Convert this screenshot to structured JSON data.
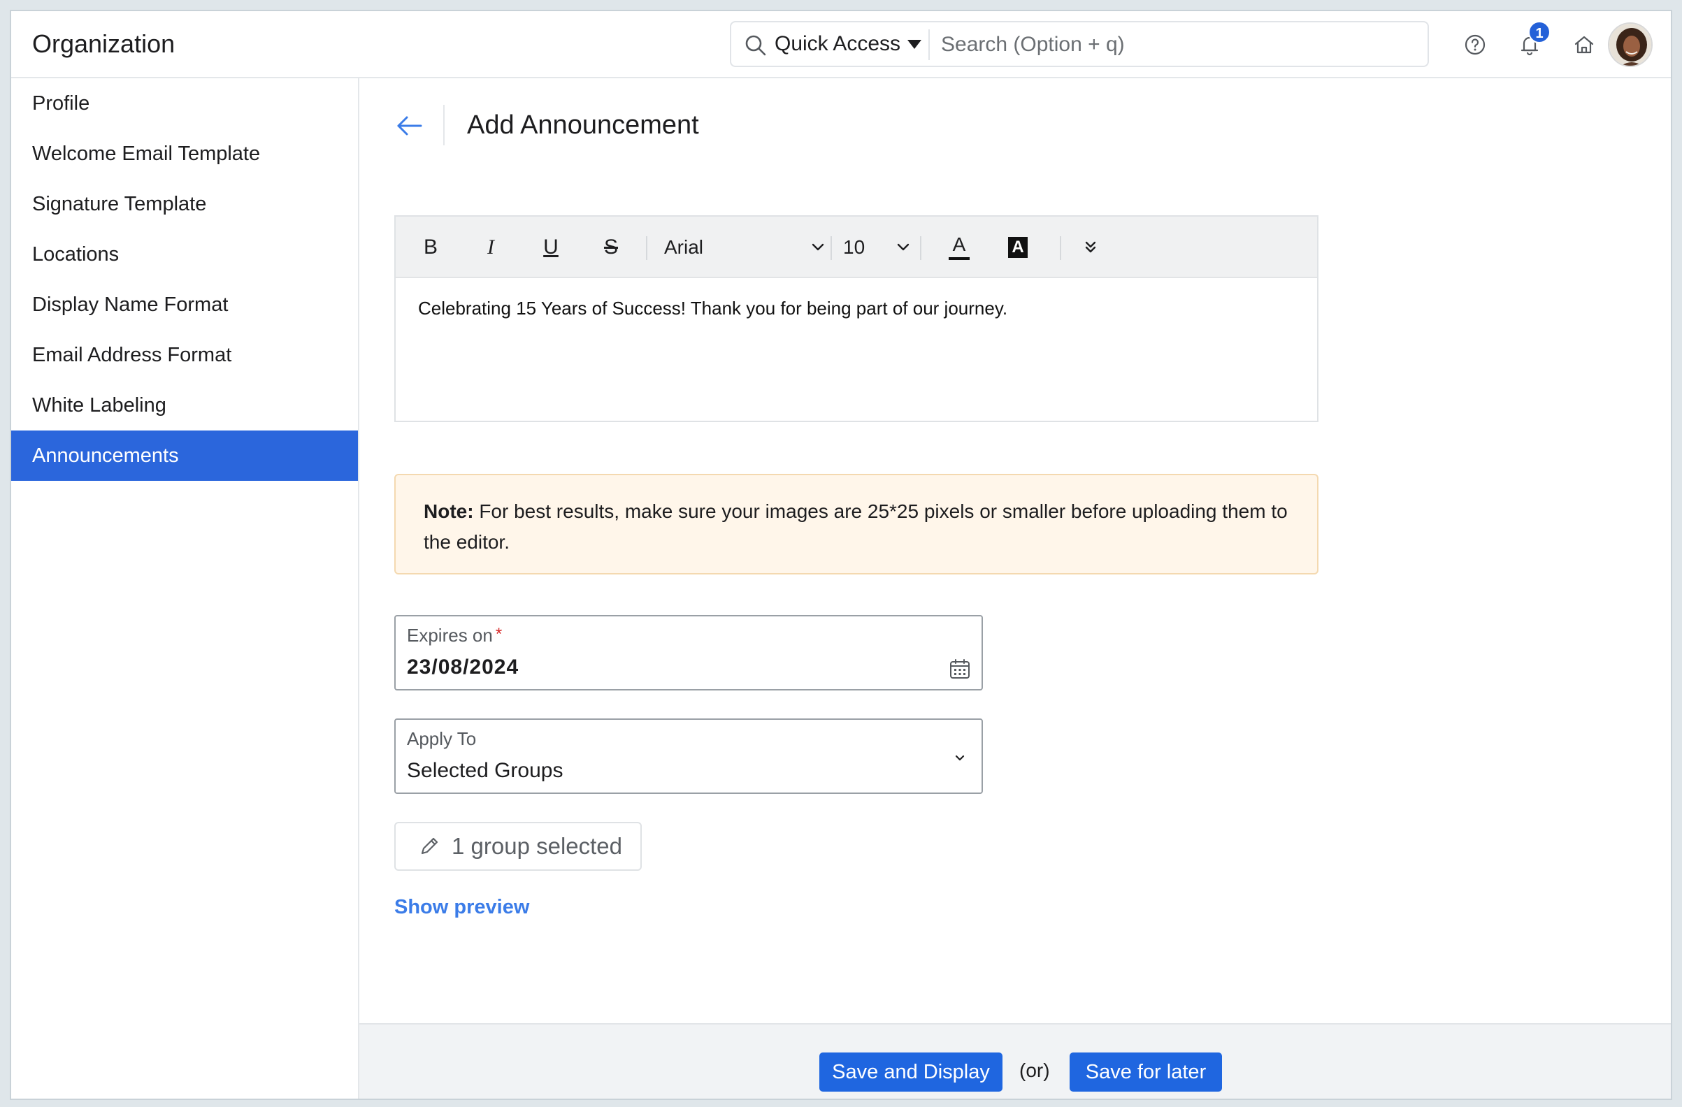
{
  "app": {
    "title": "Organization"
  },
  "header": {
    "quick_access_label": "Quick Access",
    "search_placeholder": "Search (Option + q)",
    "notification_count": "1"
  },
  "sidebar": {
    "items": [
      {
        "label": "Profile"
      },
      {
        "label": "Welcome Email Template"
      },
      {
        "label": "Signature Template"
      },
      {
        "label": "Locations"
      },
      {
        "label": "Display Name Format"
      },
      {
        "label": "Email Address Format"
      },
      {
        "label": "White Labeling"
      },
      {
        "label": "Announcements",
        "active": true
      }
    ]
  },
  "page": {
    "title": "Add Announcement"
  },
  "editor": {
    "toolbar": {
      "bold": "B",
      "italic": "I",
      "underline": "U",
      "strike": "S",
      "font": "Arial",
      "size": "10",
      "text_color": "A",
      "highlight": "A"
    },
    "content": "Celebrating 15 Years of Success! Thank you for being part of our journey."
  },
  "note": {
    "label": "Note:",
    "text": " For best results, make sure your images are 25*25 pixels or smaller before uploading them to the editor."
  },
  "form": {
    "expires_label": "Expires on",
    "expires_required": "*",
    "expires_value": "23/08/2024",
    "apply_label": "Apply To",
    "apply_value": "Selected Groups",
    "group_button": "1 group selected",
    "show_preview": "Show preview"
  },
  "footer": {
    "save_display": "Save and Display",
    "or": "(or)",
    "save_later": "Save for later"
  },
  "colors": {
    "accent": "#2b66dc",
    "primary_button": "#1f66e0",
    "link": "#3b7ce8",
    "note_bg": "#fff6ea",
    "note_border": "#f4d9b0",
    "required": "#d62828"
  }
}
